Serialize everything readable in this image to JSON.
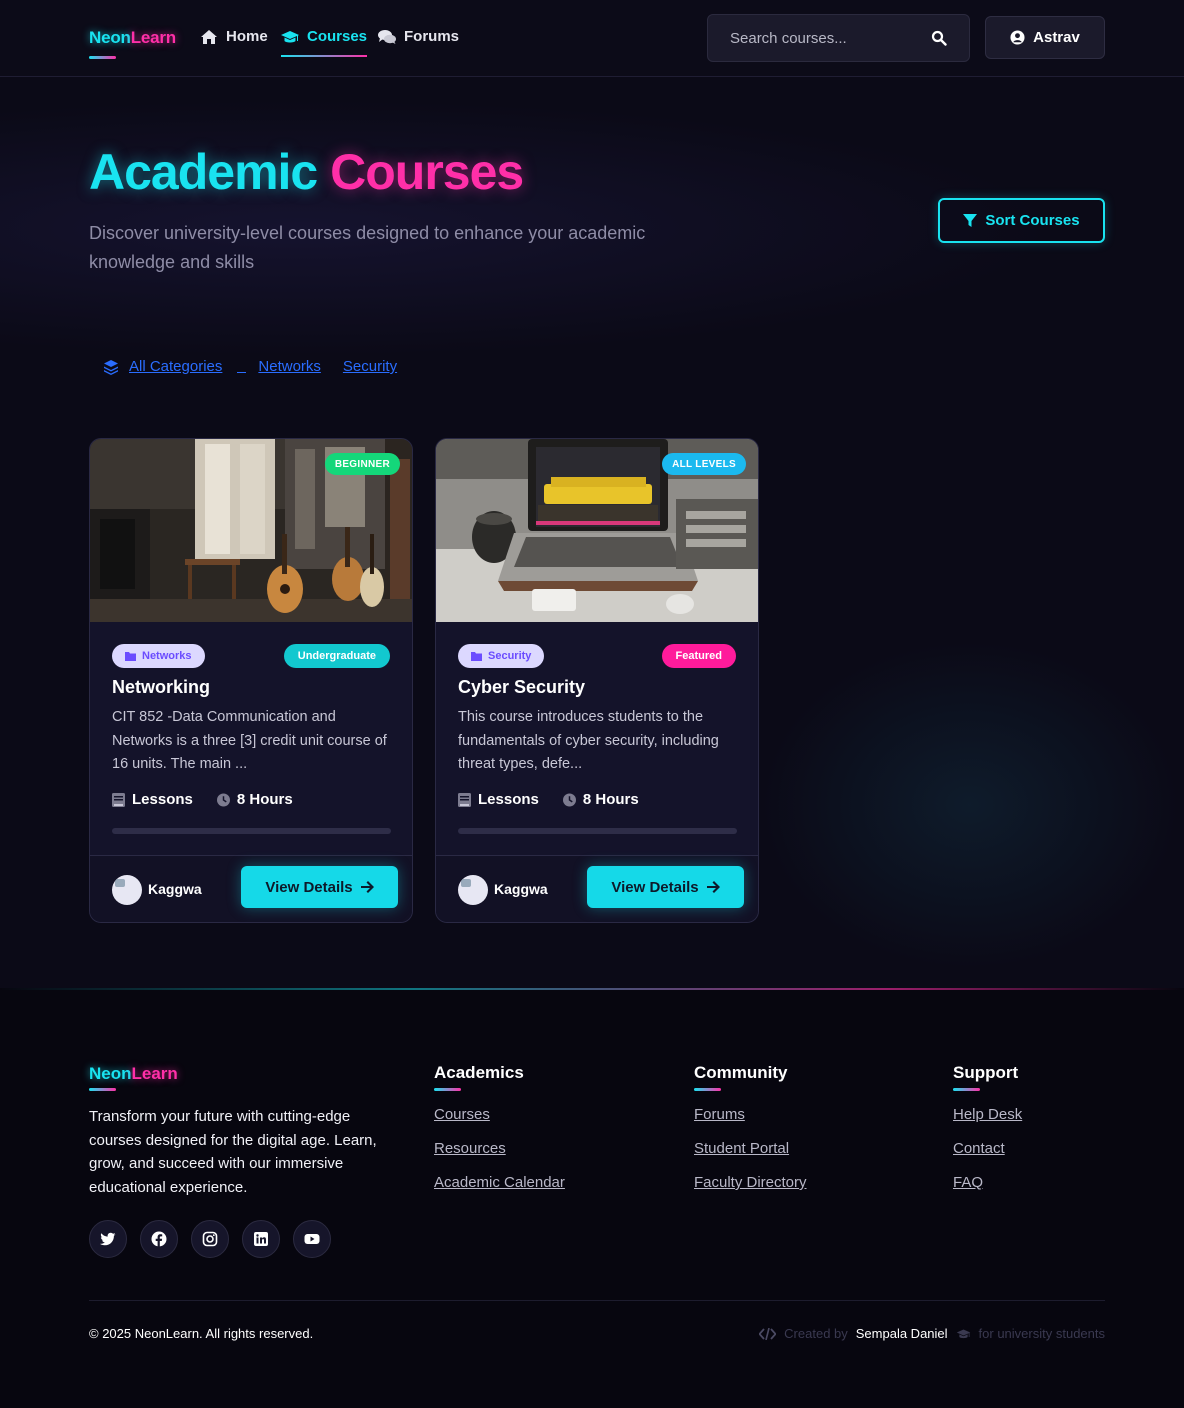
{
  "nav": {
    "logo_part1": "Neon",
    "logo_part2": "Learn",
    "links": [
      {
        "label": "Home",
        "icon": "home-icon"
      },
      {
        "label": "Courses",
        "icon": "graduation-cap-icon",
        "active": true
      },
      {
        "label": "Forums",
        "icon": "comments-icon"
      }
    ],
    "search_placeholder": "Search courses...",
    "user_name": "Astrav"
  },
  "hero": {
    "title_part1": "Academic",
    "title_part2": "Courses",
    "subtitle": "Discover university-level courses designed to enhance your academic knowledge and skills",
    "sort_label": "Sort Courses"
  },
  "categories": {
    "all_label": "All Categories",
    "items": [
      "Networks",
      "Security"
    ]
  },
  "courses": [
    {
      "level": "BEGINNER",
      "level_color": "#14d77a",
      "category": "Networks",
      "tag": "Undergraduate",
      "tag_color": "#12c8cf",
      "title": "Networking",
      "description": "CIT 852 -Data Communication and Networks is a three [3] credit unit course of 16 units. The main ...",
      "lessons_label": "Lessons",
      "hours_label": "8 Hours",
      "progress": 0,
      "author": "Kaggwa",
      "button_label": "View Details"
    },
    {
      "level": "ALL LEVELS",
      "level_color": "#1bb9ef",
      "category": "Security",
      "tag": "Featured",
      "tag_color": "#ff1b9b",
      "title": "Cyber Security",
      "description": "This course introduces students to the fundamentals of cyber security, including threat types, defe...",
      "lessons_label": "Lessons",
      "hours_label": "8 Hours",
      "progress": 0,
      "author": "Kaggwa",
      "button_label": "View Details"
    }
  ],
  "footer": {
    "logo_part1": "Neon",
    "logo_part2": "Learn",
    "about": "Transform your future with cutting-edge courses designed for the digital age. Learn, grow, and succeed with our immersive educational experience.",
    "socials": [
      "twitter-icon",
      "facebook-icon",
      "instagram-icon",
      "linkedin-icon",
      "youtube-icon"
    ],
    "columns": [
      {
        "heading": "Academics",
        "links": [
          "Courses",
          "Resources",
          "Academic Calendar"
        ]
      },
      {
        "heading": "Community",
        "links": [
          "Forums",
          "Student Portal",
          "Faculty Directory"
        ]
      },
      {
        "heading": "Support",
        "links": [
          "Help Desk",
          "Contact",
          "FAQ"
        ]
      }
    ],
    "copyright": "© 2025 NeonLearn. All rights reserved.",
    "credit_prefix": "Created by",
    "credit_name": "Sempala Daniel",
    "credit_suffix": "for university students"
  },
  "colors": {
    "cyan": "#19e3f0",
    "pink": "#ff2fa8",
    "background": "#0b0a17",
    "link_blue": "#2a6dff"
  }
}
